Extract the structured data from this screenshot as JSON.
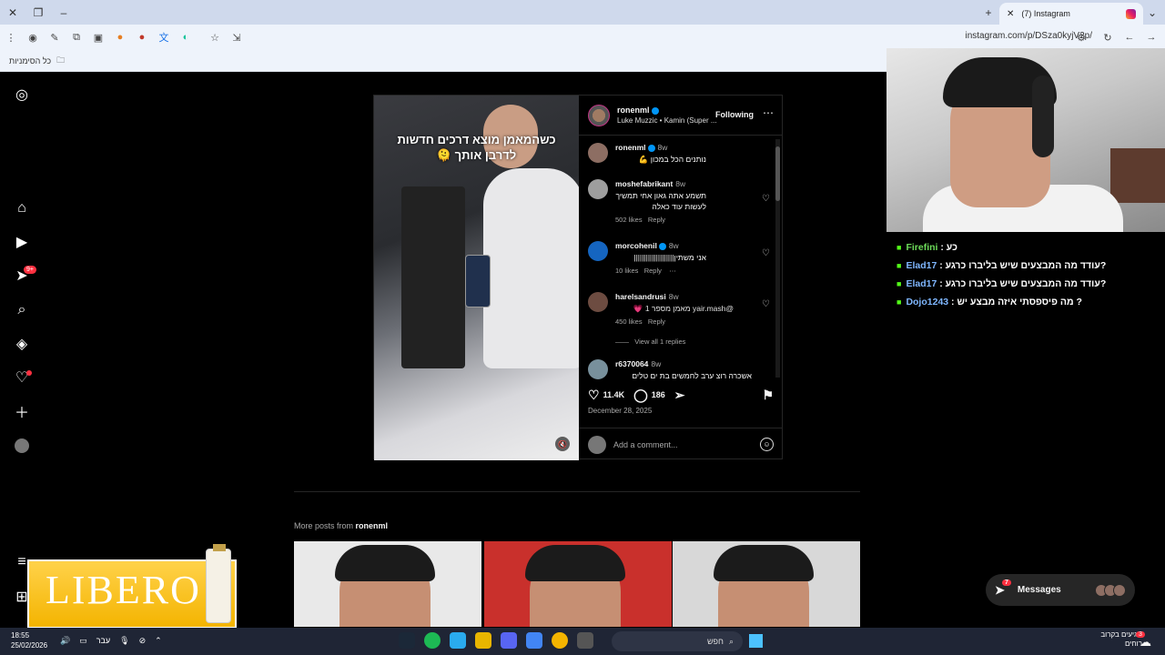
{
  "browser": {
    "tab_title": "(7) Instagram",
    "url": "instagram.com/p/DSza0kyjV2p/",
    "bookmarks_label": "כל הסימניות"
  },
  "post": {
    "username": "ronenml",
    "audio": "Luke Muzzic • Kamin (Super ...",
    "follow_label": "Following",
    "overlay_text_line1": "כשהמאמן מוצא דרכים חדשות",
    "overlay_text_line2": "לדרבן אותך 🫠",
    "comments": [
      {
        "user": "ronenml",
        "time": "8w",
        "text": "נותנים הכל במכון 💪",
        "likes": "",
        "reply": ""
      },
      {
        "user": "moshefabrikant",
        "time": "8w",
        "text": "תשמע אתה גאון אחי תמשיך לעשות עוד כאלה",
        "likes": "502 likes",
        "reply": "Reply"
      },
      {
        "user": "morcohenil",
        "time": "8w",
        "text": "אני משתין||||||||||||||||||||",
        "likes": "10 likes",
        "reply": "Reply"
      },
      {
        "user": "harelsandrusi",
        "time": "8w",
        "text": "@yair.mash מאמן מספר 1 💗",
        "likes": "450 likes",
        "reply": "Reply"
      },
      {
        "user": "r6370064",
        "time": "8w",
        "text": "אשכרה רוצ ערב לחמשים בת ים טלים",
        "likes": "",
        "reply": ""
      }
    ],
    "view_replies": "View all 1 replies",
    "likes_count": "11.4K",
    "comments_count": "186",
    "date": "December 28, 2025",
    "add_comment_placeholder": "Add a comment..."
  },
  "more_posts": {
    "prefix": "More posts from",
    "user": "ronenml"
  },
  "nav": {
    "notifications_badge": "9+"
  },
  "messages": {
    "label": "Messages",
    "count": "7"
  },
  "ad": {
    "brand": "LIBERO"
  },
  "stream_chat": [
    {
      "user": "Firefini",
      "text": ": כע"
    },
    {
      "user": "Elad17",
      "text": ": עודד מה המבצעים שיש בליברו כרגע?"
    },
    {
      "user": "Elad17",
      "text": ": עודד מה המבצעים שיש בליברו כרגע?"
    },
    {
      "user": "Dojo1243",
      "text": ": מה פיספסתי איזה מבצע יש ?"
    }
  ],
  "taskbar": {
    "time": "18:55",
    "date": "25/02/2026",
    "lang": "עבר",
    "search_placeholder": "חפש",
    "weather_line1": "מגיעים בקרוב",
    "weather_line2": "רוחים",
    "weather_badge": "3"
  },
  "colors": {
    "accent_blue": "#0095f6",
    "notification_red": "#ff3040",
    "kick_green": "#53fc18"
  }
}
